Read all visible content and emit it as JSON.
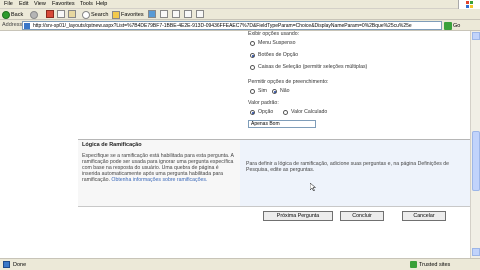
{
  "menubar": {
    "items": [
      "File",
      "Edit",
      "View",
      "Favorites",
      "Tools",
      "Help"
    ]
  },
  "toolbar": {
    "back_label": "Back",
    "search_label": "Search",
    "favorites_label": "Favorites"
  },
  "addressbar": {
    "label": "Address",
    "url": "http://srv-sp01/_layouts/qstnew.aspx?List=%7B4DE79BF7-1BBE-4E2E-913D-09436FFEAEC7%7D&FieldTypeParam=Choice&DisplayNameParam=0%2Bque%25cu%25e",
    "go_label": "Go"
  },
  "form": {
    "display_choices_label": "Exibir opções usando:",
    "display_options": [
      {
        "label": "Menu Suspenso",
        "selected": false
      },
      {
        "label": "Botões de Opção",
        "selected": true
      },
      {
        "label": "Caixas de Seleção (permitir seleções múltiplas)",
        "selected": false
      }
    ],
    "fillin_label": "Permitir opções de preenchimento:",
    "fillin_options": [
      {
        "label": "Sim",
        "selected": false
      },
      {
        "label": "Não",
        "selected": true
      }
    ],
    "default_label": "Valor padrão:",
    "default_options": [
      {
        "label": "Opção",
        "selected": true
      },
      {
        "label": "Valor Calculado",
        "selected": false
      }
    ],
    "default_value": "Apenas Bom"
  },
  "branching": {
    "title": "Lógica de Ramificação",
    "description": "Especifique se a ramificação está habilitada para esta pergunta. A ramificação pode ser usada para ignorar uma pergunta específica com base na resposta do usuário. Uma quebra de página é inserida automaticamente após uma pergunta habilitada para ramificação.",
    "link_text": "Obtenha informações sobre ramificações.",
    "right_text": "Para definir a lógica de ramificação, adicione suas perguntas e, na página Definições de Pesquisa, edite as perguntas."
  },
  "buttons": {
    "next_question": "Próxima Pergunta",
    "finish": "Concluir",
    "cancel": "Cancelar"
  },
  "status": {
    "left_text": "Done",
    "right_text": "Trusted sites"
  }
}
